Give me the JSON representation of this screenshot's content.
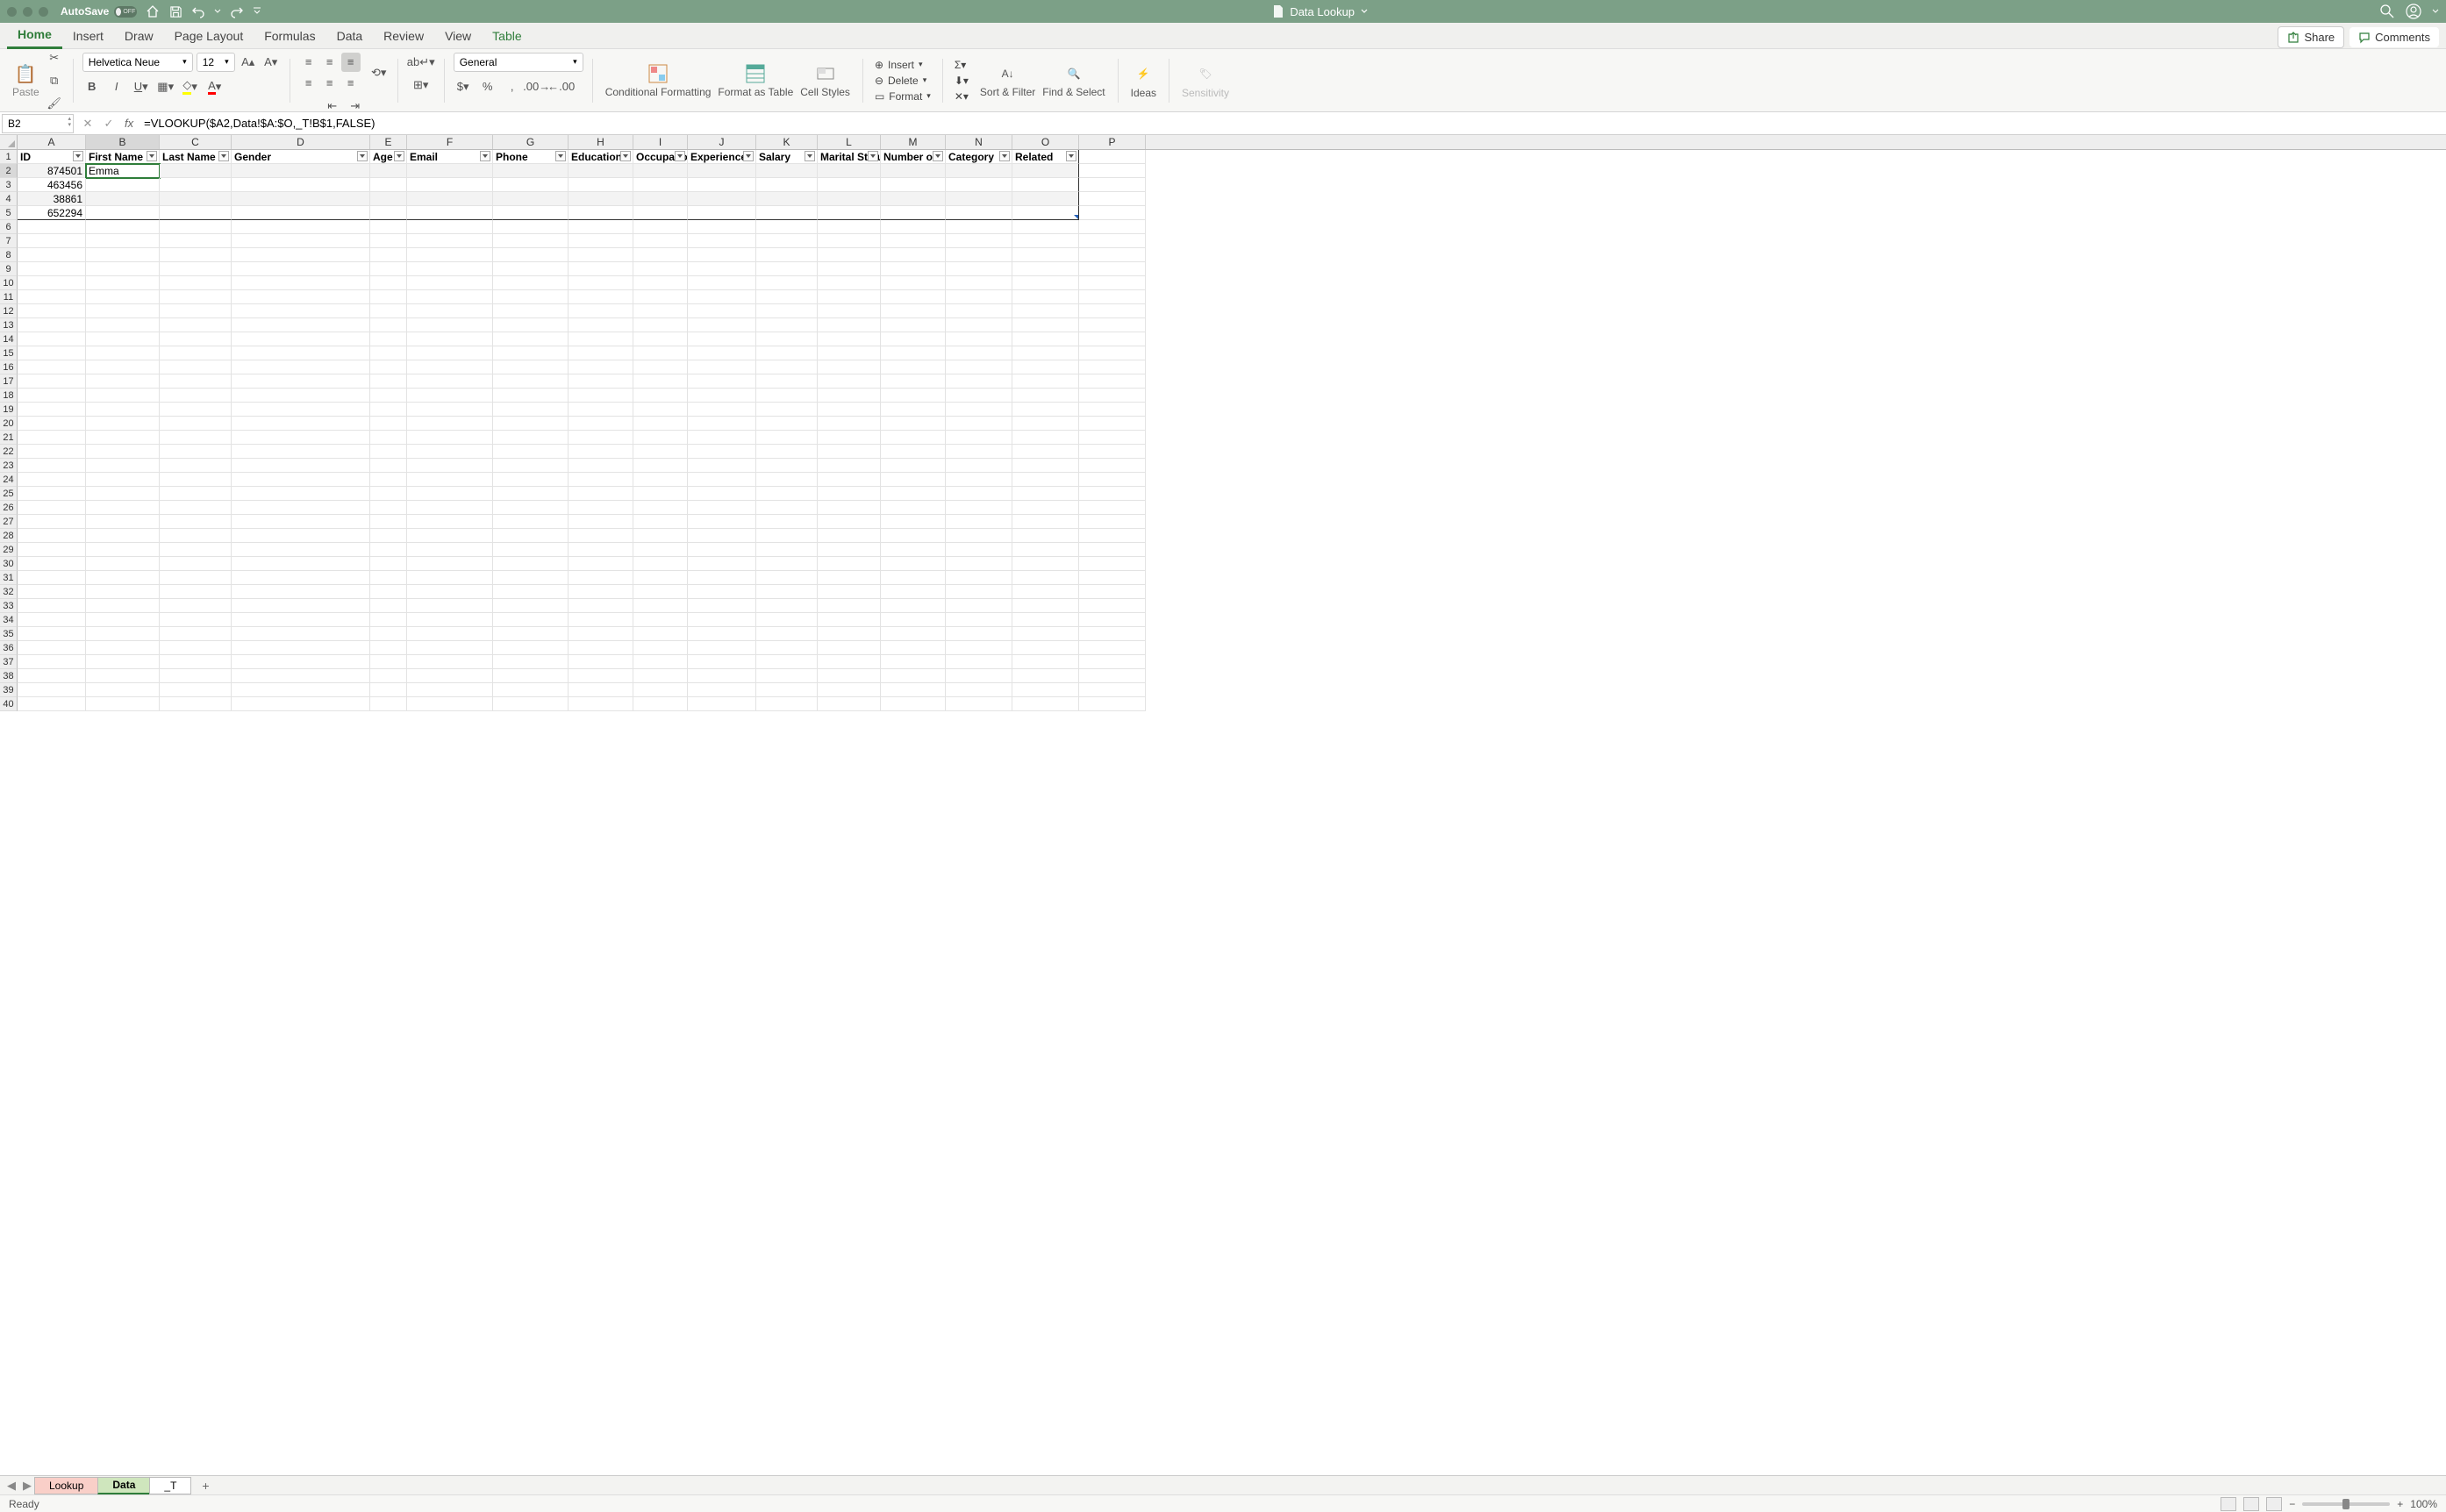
{
  "title_bar": {
    "autosave_label": "AutoSave",
    "autosave_state": "OFF",
    "document_name": "Data Lookup"
  },
  "ribbon": {
    "tabs": [
      "Home",
      "Insert",
      "Draw",
      "Page Layout",
      "Formulas",
      "Data",
      "Review",
      "View",
      "Table"
    ],
    "active_tab": "Home",
    "share_label": "Share",
    "comments_label": "Comments",
    "paste_label": "Paste",
    "font_name": "Helvetica Neue",
    "font_size": "12",
    "number_format": "General",
    "groups": {
      "conditional_formatting": "Conditional Formatting",
      "format_as_table": "Format as Table",
      "cell_styles": "Cell Styles",
      "insert": "Insert",
      "delete": "Delete",
      "format": "Format",
      "sort_filter": "Sort & Filter",
      "find_select": "Find & Select",
      "ideas": "Ideas",
      "sensitivity": "Sensitivity"
    }
  },
  "formula_bar": {
    "cell_ref": "B2",
    "fx_label": "fx",
    "formula": "=VLOOKUP($A2,Data!$A:$O,_T!B$1,FALSE)"
  },
  "columns": [
    {
      "letter": "A",
      "width": 78
    },
    {
      "letter": "B",
      "width": 84
    },
    {
      "letter": "C",
      "width": 82
    },
    {
      "letter": "D",
      "width": 158
    },
    {
      "letter": "E",
      "width": 42
    },
    {
      "letter": "F",
      "width": 98
    },
    {
      "letter": "G",
      "width": 86
    },
    {
      "letter": "H",
      "width": 74
    },
    {
      "letter": "I",
      "width": 62
    },
    {
      "letter": "J",
      "width": 78
    },
    {
      "letter": "K",
      "width": 70
    },
    {
      "letter": "L",
      "width": 72
    },
    {
      "letter": "M",
      "width": 74
    },
    {
      "letter": "N",
      "width": 76
    },
    {
      "letter": "O",
      "width": 76
    },
    {
      "letter": "P",
      "width": 76
    }
  ],
  "table_headers": [
    "ID",
    "First Name",
    "Last Name",
    "Gender",
    "Age",
    "Email",
    "Phone",
    "Education",
    "Occupation",
    "Experience",
    "Salary",
    "Marital Status",
    "Number of",
    "Category",
    "Related"
  ],
  "data_rows": [
    {
      "A": "874501",
      "B": "Emma"
    },
    {
      "A": "463456"
    },
    {
      "A": "38861"
    },
    {
      "A": "652294"
    }
  ],
  "row_count": 40,
  "selected_cell": "B2",
  "sheet_tabs": {
    "lookup": "Lookup",
    "data": "Data",
    "t": "_T"
  },
  "status_bar": {
    "ready": "Ready",
    "zoom": "100%"
  }
}
